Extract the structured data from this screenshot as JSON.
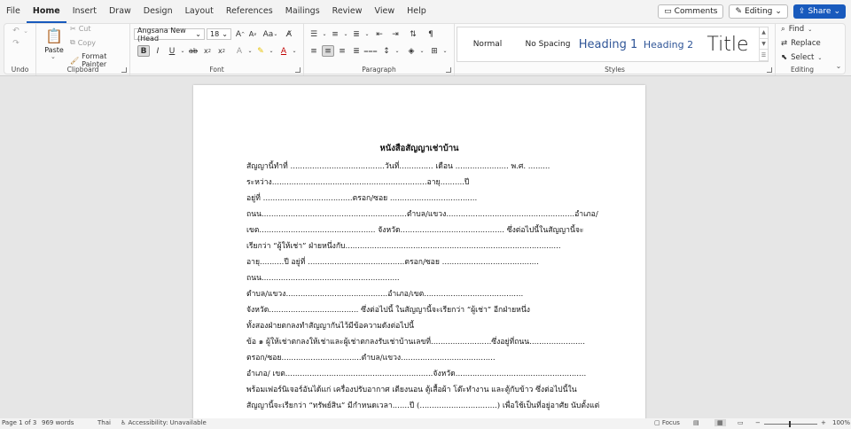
{
  "menu": {
    "items": [
      "File",
      "Home",
      "Insert",
      "Draw",
      "Design",
      "Layout",
      "References",
      "Mailings",
      "Review",
      "View",
      "Help"
    ],
    "active": "Home",
    "comments_label": "Comments",
    "editing_label": "Editing",
    "share_label": "Share"
  },
  "ribbon": {
    "undo": {
      "label": "Undo"
    },
    "clipboard": {
      "label": "Clipboard",
      "paste": "Paste",
      "cut": "Cut",
      "copy": "Copy",
      "format_painter": "Format Painter"
    },
    "font": {
      "label": "Font",
      "font_name": "Angsana New (Head",
      "font_size": "18",
      "grow": "A",
      "shrink": "A",
      "case": "Aa",
      "bold": "B",
      "italic": "I",
      "underline": "U",
      "strike": "ab",
      "sub": "x",
      "sup": "x"
    },
    "paragraph": {
      "label": "Paragraph"
    },
    "styles": {
      "label": "Styles",
      "items": [
        "Normal",
        "No Spacing",
        "Heading 1",
        "Heading 2",
        "Title"
      ]
    },
    "editing": {
      "label": "Editing",
      "find": "Find",
      "replace": "Replace",
      "select": "Select"
    }
  },
  "document": {
    "title": "หนังสือสัญญาเช่าบ้าน",
    "lines": [
      "สัญญานี้ทำที่ .......................................วันที่.............. เดือน ...................... พ.ศ. .........",
      "ระหว่าง................................................................อายุ..........ปี",
      "อยู่ที่ .....................................ตรอก/ซอย ....................................",
      "ถนน............................................................ตำบล/แขวง.....................................................อำเภอ/",
      "เขต................................................ จังหวัด........................................... ซึ่งต่อไปนี้ในสัญญานี้จะ",
      "เรียกว่า “ผู้ให้เช่า” ฝ่ายหนึ่งกับ.........................................................................................",
      "อายุ..........ปี อยู่ที่ ........................................ตรอก/ซอย ........................................",
      "ถนน.........................................................",
      "ตำบล/แขวง..........................................อำเภอ/เขต.........................................",
      "จังหวัด..................................... ซึ่งต่อไปนี้ ในสัญญานี้จะเรียกว่า “ผู้เช่า” อีกฝ่ายหนึ่ง",
      "ทั้งสองฝ่ายตกลงทำสัญญากันไว้มีข้อความดังต่อไปนี้",
      "ข้อ ๑ ผู้ให้เช่าตกลงให้เช่าและผู้เช่าตกลงรับเช่าบ้านเลขที่.........................ซึ่งอยู่ที่ถนน.......................",
      "ตรอก/ซอย.................................ตำบล/แขวง.......................................",
      "อำเภอ/ เขต.............................................................จังหวัด......................................................",
      "พร้อมเฟอร์นิเจอร์อันได้แก่ เครื่องปรับอากาศ เตียงนอน ตู้เสื้อผ้า โต๊ะทำงาน และตู้กับข้าว ซึ่งต่อไปนี้ใน",
      "สัญญานี้จะเรียกว่า “ทรัพย์สิน” มีกำหนดเวลา.......ปี (................................) เพื่อใช้เป็นที่อยู่อาศัย นับตั้งแต่"
    ]
  },
  "status": {
    "page": "Page 1 of 3",
    "words": "969 words",
    "language": "Thai",
    "accessibility": "Accessibility: Unavailable",
    "focus": "Focus",
    "zoom": "100%"
  }
}
